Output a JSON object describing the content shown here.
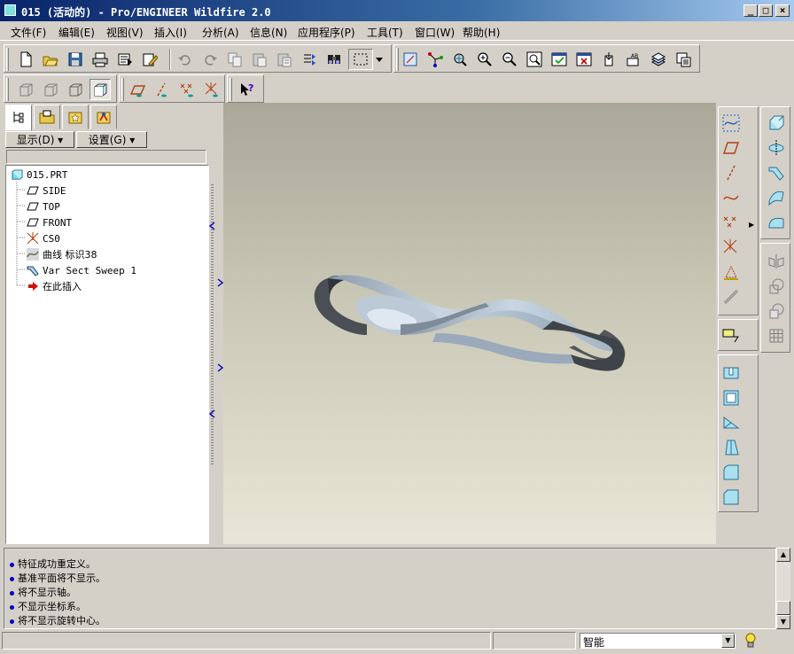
{
  "window": {
    "title": "015 (活动的) - Pro/ENGINEER Wildfire 2.0",
    "min_symbol": "_",
    "max_symbol": "□",
    "close_symbol": "×"
  },
  "menu": [
    {
      "key": "file",
      "label": "文件(F)"
    },
    {
      "key": "edit",
      "label": "编辑(E)"
    },
    {
      "key": "view",
      "label": "视图(V)"
    },
    {
      "key": "insert",
      "label": "插入(I)"
    },
    {
      "key": "analysis",
      "label": "分析(A)"
    },
    {
      "key": "info",
      "label": "信息(N)"
    },
    {
      "key": "apps",
      "label": "应用程序(P)"
    },
    {
      "key": "tools",
      "label": "工具(T)"
    },
    {
      "key": "window",
      "label": "窗口(W)"
    },
    {
      "key": "help",
      "label": "帮助(H)"
    }
  ],
  "left_panel": {
    "show_label": "显示(D) ▾",
    "settings_label": "设置(G) ▾",
    "tree": [
      {
        "label": "015.PRT",
        "icon": "part-icon"
      },
      {
        "label": "SIDE",
        "icon": "datum-plane-icon"
      },
      {
        "label": "TOP",
        "icon": "datum-plane-icon"
      },
      {
        "label": "FRONT",
        "icon": "datum-plane-icon"
      },
      {
        "label": "CS0",
        "icon": "coordinate-system-icon"
      },
      {
        "label": "曲线 标识38",
        "icon": "curve-icon"
      },
      {
        "label": "Var Sect Sweep 1",
        "icon": "sweep-icon"
      },
      {
        "label": "在此插入",
        "icon": "insert-here-arrow-icon"
      }
    ]
  },
  "messages": [
    "特征成功重定义。",
    "基准平面将不显示。",
    "将不显示轴。",
    "不显示坐标系。",
    "将不显示旋转中心。"
  ],
  "status": {
    "filter_value": "智能"
  },
  "colors": {
    "title_start": "#0a246a",
    "title_end": "#a6caf0",
    "model_face": "#a9b8c6",
    "model_inner": "#4a4f55",
    "message_bullet": "#0000c0"
  }
}
